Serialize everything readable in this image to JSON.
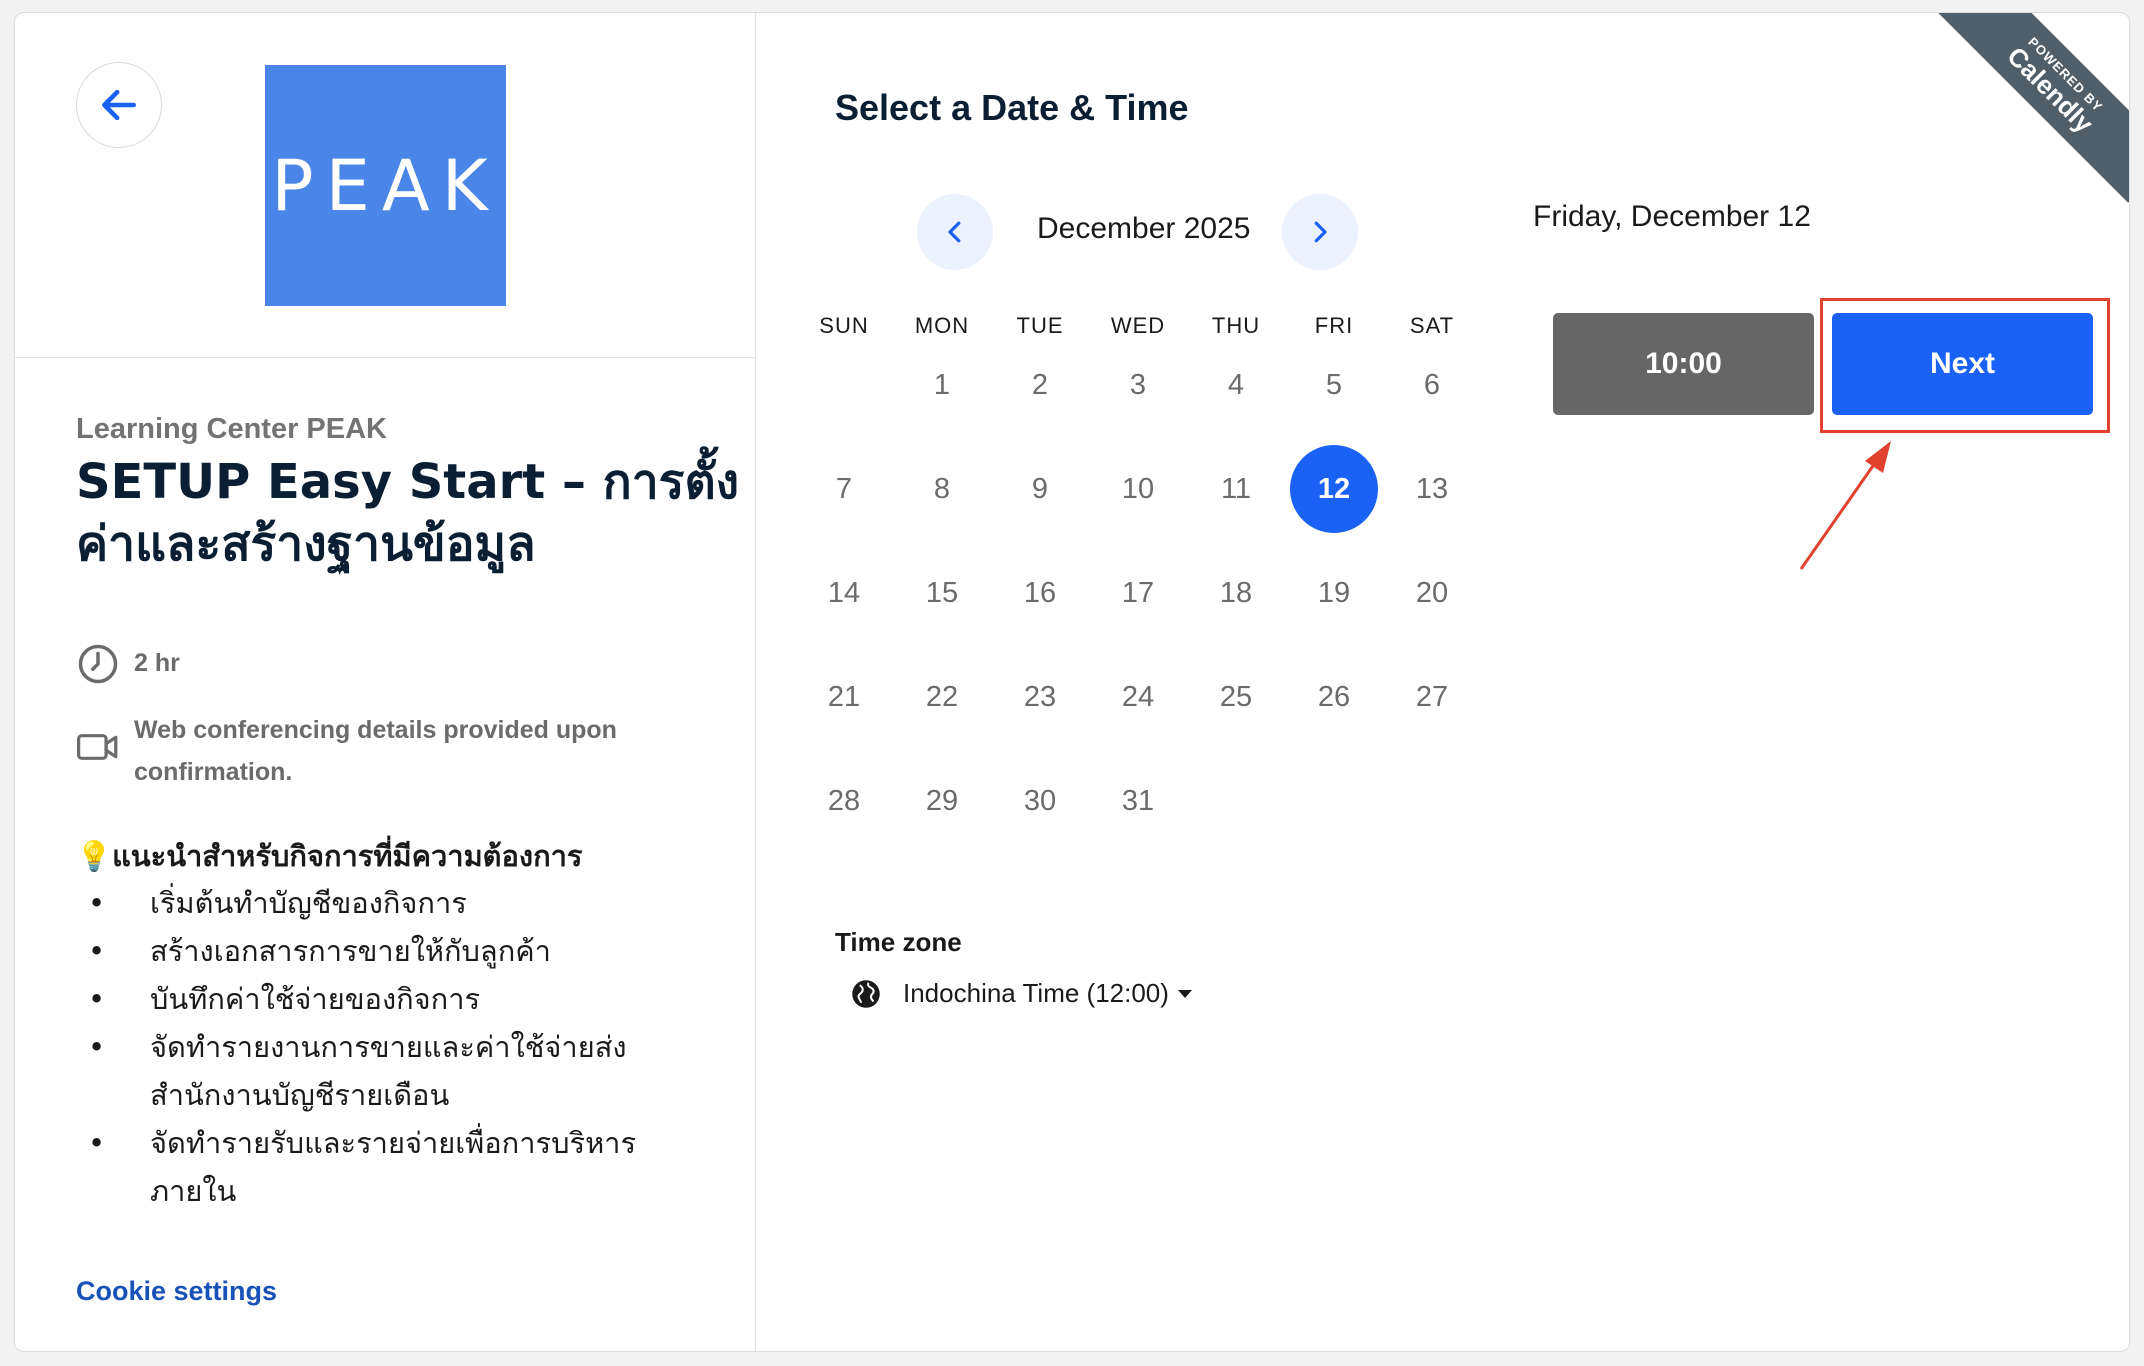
{
  "org_name": "Learning Center PEAK",
  "logo_text": "PEAK",
  "event_title": "SETUP Easy Start – การตั้งค่าและสร้างฐานข้อมูล",
  "duration": "2 hr",
  "conferencing": "Web conferencing details provided upon confirmation.",
  "recommendation": {
    "title": "💡แนะนำสำหรับกิจการที่มีความต้องการ",
    "items": [
      "เริ่มต้นทำบัญชีของกิจการ",
      "สร้างเอกสารการขายให้กับลูกค้า",
      "บันทึกค่าใช้จ่ายของกิจการ",
      "จัดทำรายงานการขายและค่าใช้จ่ายส่งสำนักงานบัญชีรายเดือน",
      "จัดทำรายรับและรายจ่ายเพื่อการบริหารภายใน"
    ]
  },
  "cookie_settings": "Cookie settings",
  "select_title": "Select a Date & Time",
  "calendar": {
    "month_label": "December 2025",
    "weekdays": [
      "SUN",
      "MON",
      "TUE",
      "WED",
      "THU",
      "FRI",
      "SAT"
    ],
    "first_weekday_index": 1,
    "days_in_month": 31,
    "selected_day": 12
  },
  "timezone": {
    "label": "Time zone",
    "value": "Indochina Time (12:00)"
  },
  "selected_date_heading": "Friday, December 12",
  "time_slot": "10:00",
  "next_label": "Next",
  "ribbon": {
    "powered_by": "POWERED BY",
    "brand": "Calendly"
  },
  "colors": {
    "primary": "#1a61f5",
    "slot_selected": "#666666",
    "highlight_outline": "#e0422f",
    "logo_bg": "#4a86e8"
  }
}
